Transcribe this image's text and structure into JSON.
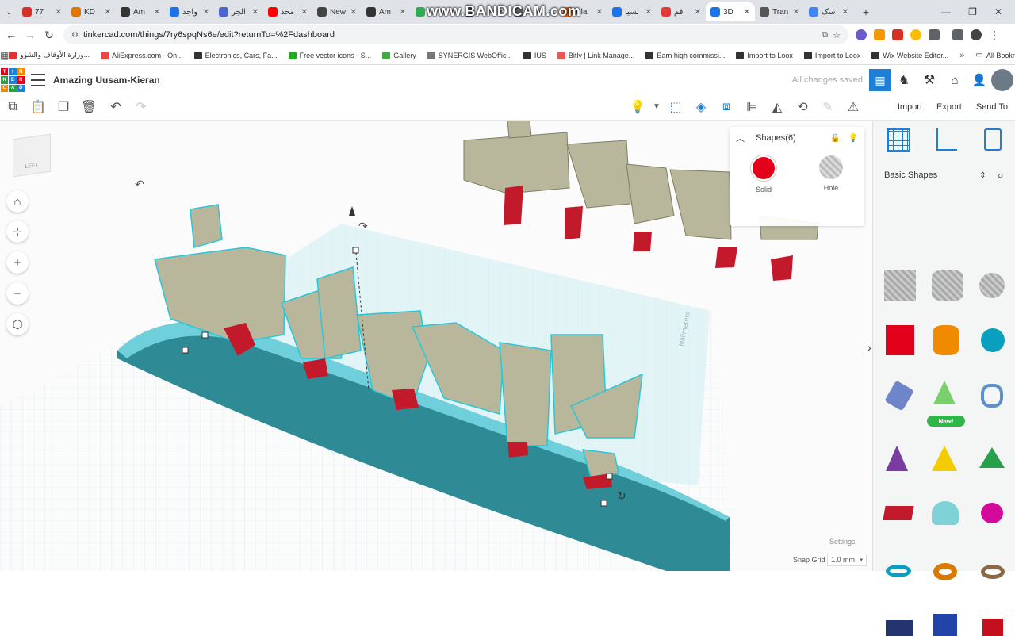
{
  "browser": {
    "tabs": [
      {
        "label": "77",
        "color": "#d93025"
      },
      {
        "label": "KD",
        "color": "#e37400"
      },
      {
        "label": "Am",
        "color": "#333333"
      },
      {
        "label": "واجد",
        "color": "#1a73e8"
      },
      {
        "label": "الجر",
        "color": "#4a66d0"
      },
      {
        "label": "محد",
        "color": "#ff0000"
      },
      {
        "label": "New",
        "color": "#444444"
      },
      {
        "label": "Am",
        "color": "#333333"
      },
      {
        "label": "",
        "color": "#34a853"
      },
      {
        "label": "",
        "color": "#5f6368"
      },
      {
        "label": "",
        "color": "#5f6368"
      },
      {
        "label": "Pla",
        "color": "#ff6600"
      },
      {
        "label": "بسيا",
        "color": "#1a73e8"
      },
      {
        "label": "فم",
        "color": "#e53935"
      },
      {
        "label": "3D",
        "color": "#1a73e8"
      },
      {
        "label": "Tran",
        "color": "#555555"
      },
      {
        "label": "سک",
        "color": "#4285f4"
      }
    ],
    "watermark": "www.BANDICAM.com",
    "url": "tinkercad.com/things/7ry6spqNs6e/edit?returnTo=%2Fdashboard",
    "bookmarks": [
      "وزارة الأوقاف والشؤو...",
      "AliExpress.com - On...",
      "Electronics, Cars, Fa...",
      "Free vector icons - S...",
      "Gallery",
      "SYNERGIS WebOffic...",
      "IUS",
      "Bitly | Link Manage...",
      "Earn high commissi...",
      "Import to Loox",
      "Import to Loox",
      "Wix Website Editor..."
    ],
    "all_bookmarks": "All Bookmarks"
  },
  "app": {
    "logo_letters": [
      "TIN",
      "KER",
      "CAD"
    ],
    "logo_cells": [
      "T",
      "I",
      "N",
      "K",
      "E",
      "R",
      "C",
      "A",
      "D"
    ],
    "project_title": "Amazing Uusam-Kieran",
    "save_status": "All changes saved",
    "import_label": "Import",
    "export_label": "Export",
    "send_to_label": "Send To"
  },
  "shapes_panel": {
    "title": "Shapes(6)",
    "solid_label": "Solid",
    "hole_label": "Hole",
    "solid_color": "#e3001b"
  },
  "library": {
    "category": "Basic Shapes",
    "new_badge": "New!"
  },
  "footer": {
    "settings_label": "Settings",
    "snap_grid_label": "Snap Grid",
    "snap_grid_value": "1.0 mm"
  },
  "workplane": {
    "units_label": "Millimeters",
    "viewcube_label": "LEFT"
  },
  "colors": {
    "accent": "#1f7ed6",
    "selection": "#28c7d8",
    "teal_base": "#2e8a94",
    "letters": "#b8b79c",
    "hole_red": "#c21a2a"
  }
}
